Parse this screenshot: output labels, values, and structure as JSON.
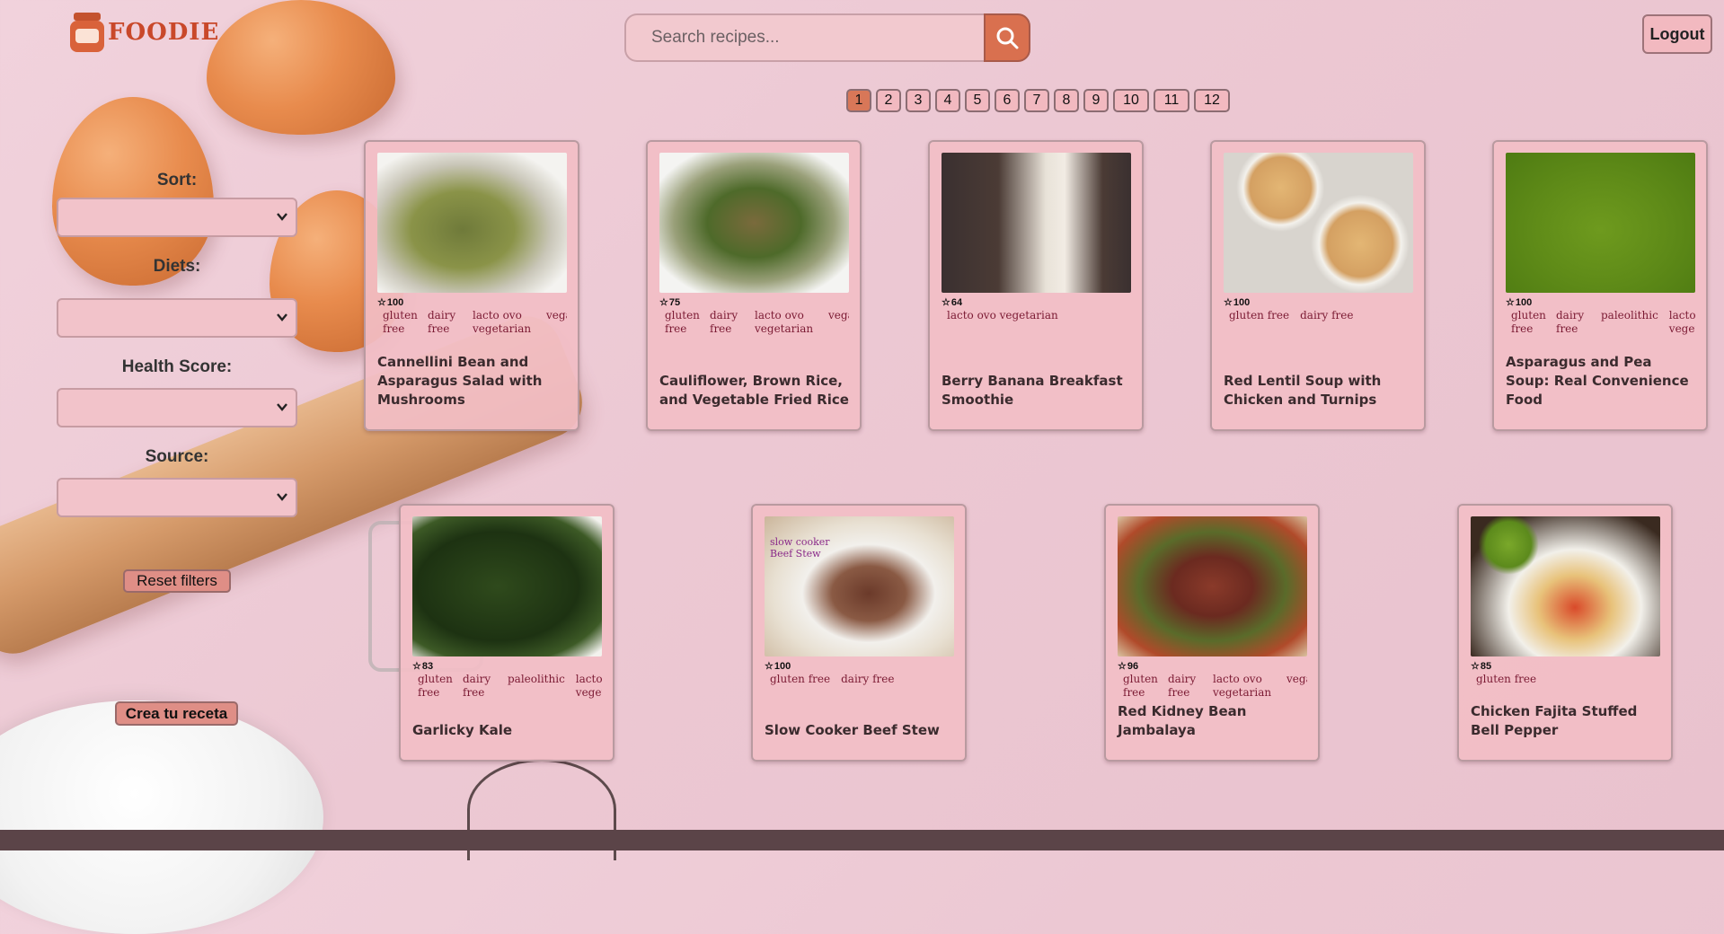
{
  "header": {
    "logo_text": "FOODIE",
    "search": {
      "placeholder": "Search recipes...",
      "value": ""
    },
    "logout_label": "Logout"
  },
  "pagination": {
    "pages": [
      "1",
      "2",
      "3",
      "4",
      "5",
      "6",
      "7",
      "8",
      "9",
      "10",
      "11",
      "12"
    ],
    "active": "1"
  },
  "filters": {
    "sort_label": "Sort:",
    "diets_label": "Diets:",
    "health_label": "Health Score:",
    "source_label": "Source:",
    "reset_label": "Reset filters",
    "create_label": "Crea tu receta"
  },
  "recipes": [
    {
      "title": "Cannellini Bean and Asparagus Salad with Mushrooms",
      "score": "100",
      "diets": [
        "gluten free",
        "dairy free",
        "lacto ovo vegetarian",
        "vegan"
      ]
    },
    {
      "title": "Cauliflower, Brown Rice, and Vegetable Fried Rice",
      "score": "75",
      "diets": [
        "gluten free",
        "dairy free",
        "lacto ovo vegetarian",
        "vegan"
      ]
    },
    {
      "title": "Berry Banana Breakfast Smoothie",
      "score": "64",
      "diets": [
        "lacto ovo vegetarian"
      ]
    },
    {
      "title": "Red Lentil Soup with Chicken and Turnips",
      "score": "100",
      "diets": [
        "gluten free",
        "dairy free"
      ]
    },
    {
      "title": "Asparagus and Pea Soup: Real Convenience Food",
      "score": "100",
      "diets": [
        "gluten free",
        "dairy free",
        "paleolithic",
        "lacto ovo vegetarian"
      ]
    },
    {
      "title": "Garlicky Kale",
      "score": "83",
      "diets": [
        "gluten free",
        "dairy free",
        "paleolithic",
        "lacto ovo vegetarian"
      ]
    },
    {
      "title": "Slow Cooker Beef Stew",
      "score": "100",
      "diets": [
        "gluten free",
        "dairy free"
      ]
    },
    {
      "title": "Red Kidney Bean Jambalaya",
      "score": "96",
      "diets": [
        "gluten free",
        "dairy free",
        "lacto ovo vegetarian",
        "vegan"
      ]
    },
    {
      "title": "Chicken Fajita Stuffed Bell Pepper",
      "score": "85",
      "diets": [
        "gluten free"
      ]
    }
  ],
  "image_overlay": {
    "slow_cooker_caption": "slow cooker Beef Stew"
  },
  "colors": {
    "accent": "#d9704f",
    "card_bg": "#f2bec6",
    "diet_text": "#7b1a33",
    "page_bg": "#ecc8d3"
  }
}
